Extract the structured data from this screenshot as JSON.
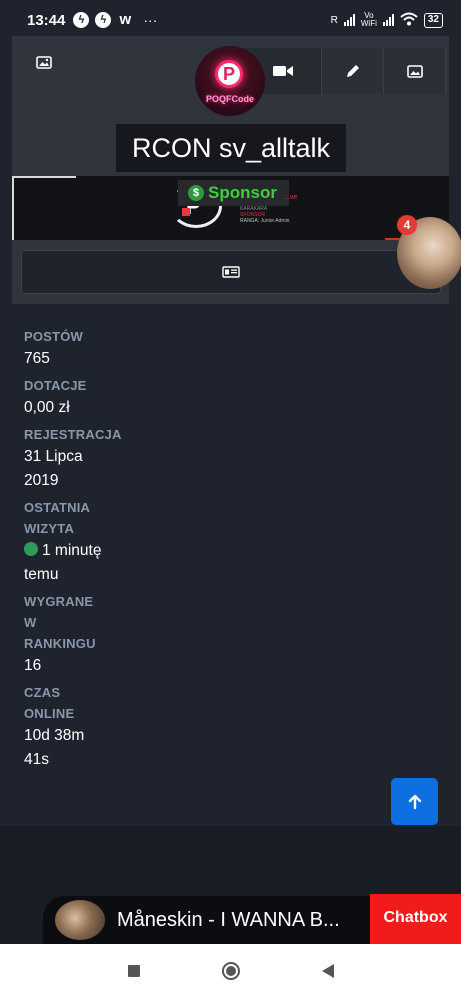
{
  "status_bar": {
    "time": "13:44",
    "notification_icons": [
      "messenger-icon",
      "messenger-icon",
      "app-w-icon"
    ],
    "more": "···",
    "signal_label_1": "R",
    "signal_label_2": "Vo\nWiFi",
    "battery": "32"
  },
  "profile": {
    "avatar_text": "POQFCode",
    "avatar_letter": "P",
    "title": "RCON sv_alltalk",
    "toolbar": [
      "video-icon",
      "pencil-icon",
      "image-icon"
    ],
    "banner": {
      "sponsor_label": "Sponsor",
      "sponsor_icon_char": "$",
      "emblem_letter": "P",
      "tiny_lines": [
        "...ve",
        "KARAKARA",
        "SPONSOR",
        "RANGA: Junior Admin"
      ]
    }
  },
  "notification": {
    "badge_count": "4"
  },
  "stats": [
    {
      "label": "POSTÓW",
      "value": "765"
    },
    {
      "label": "DOTACJE",
      "value": "0,00 zł"
    },
    {
      "label": "REJESTRACJA",
      "value": "31 Lipca 2019"
    },
    {
      "label": "OSTATNIA WIZYTA",
      "value": "1 minutę temu"
    },
    {
      "label": "WYGRANE W RANKINGU",
      "value": "16"
    },
    {
      "label": "CZAS ONLINE",
      "value": "10d 38m 41s"
    }
  ],
  "player": {
    "song": "Måneskin - I WANNA B..."
  },
  "chatbox": {
    "label": "Chatbox"
  },
  "colors": {
    "background": "#1e232d",
    "card": "#2f343d",
    "accent": "#0d6ee0",
    "chatbox": "#f11b1b",
    "online": "#2e9b5a"
  }
}
